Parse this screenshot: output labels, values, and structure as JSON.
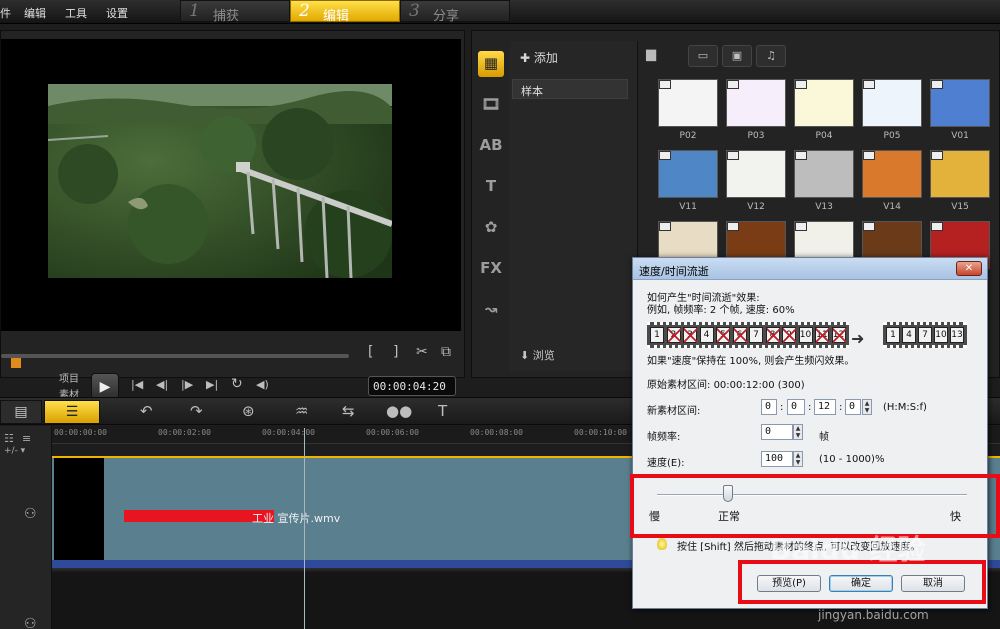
{
  "menu": {
    "items": [
      "件",
      "编辑",
      "工具",
      "设置"
    ]
  },
  "steps": [
    {
      "num": "1",
      "label": "捕获"
    },
    {
      "num": "2",
      "label": "编辑"
    },
    {
      "num": "3",
      "label": "分享"
    }
  ],
  "preview": {
    "mode_project": "项目",
    "mode_clip": "素材",
    "timecode": "00:00:04:20",
    "controls": {
      "mark_in": "[",
      "mark_out": "]",
      "cut": "✂",
      "resize": "⧉",
      "play": "▶",
      "home": "|◀",
      "prev": "◀|",
      "next": "|▶",
      "end": "▶|",
      "repeat": "↻",
      "volume": "◀)"
    }
  },
  "library": {
    "add_label": "添加",
    "folder": "样本",
    "browse_label": "浏览",
    "side_icons": [
      "media-icon",
      "transition-icon",
      "title-ab-icon",
      "text-t-icon",
      "graphics-icon",
      "fx-icon",
      "path-icon"
    ],
    "side_glyphs": [
      "▦",
      "🎞",
      "AB",
      "T",
      "✿",
      "FX",
      "↝"
    ],
    "tab_glyphs": [
      "▭",
      "▣",
      "♫"
    ],
    "thumbs": [
      {
        "label": "P02",
        "color": "#f4f4f4",
        "kind": "photo"
      },
      {
        "label": "P03",
        "color": "#f7eefb",
        "kind": "photo"
      },
      {
        "label": "P04",
        "color": "#fbf7d9",
        "kind": "photo"
      },
      {
        "label": "P05",
        "color": "#eef4fb",
        "kind": "photo"
      },
      {
        "label": "V01",
        "color": "#4e7fd0",
        "kind": "video"
      },
      {
        "label": "V11",
        "color": "#4f86c6",
        "kind": "video"
      },
      {
        "label": "V12",
        "color": "#f2f2ee",
        "kind": "video"
      },
      {
        "label": "V13",
        "color": "#bdbdbd",
        "kind": "video"
      },
      {
        "label": "V14",
        "color": "#d9792b",
        "kind": "video"
      },
      {
        "label": "V15",
        "color": "#e2b23a",
        "kind": "video"
      },
      {
        "label": "",
        "color": "#e8dcc4",
        "kind": "video"
      },
      {
        "label": "",
        "color": "#7a3c15",
        "kind": "video"
      },
      {
        "label": "",
        "color": "#f1f1ea",
        "kind": "video"
      },
      {
        "label": "",
        "color": "#6b3a18",
        "kind": "video"
      },
      {
        "label": "",
        "color": "#b52020",
        "kind": "video"
      }
    ]
  },
  "timeline": {
    "ruler": [
      "00:00:00:00",
      "00:00:02:00",
      "00:00:04:00",
      "00:00:06:00",
      "00:00:08:00",
      "00:00:10:00"
    ],
    "clip_name": "工业 宣传片.wmv",
    "tools": [
      "↶",
      "↷",
      "⊛",
      "♒",
      "⇆",
      "●●",
      "T"
    ]
  },
  "dialog": {
    "title": "速度/时间流逝",
    "close": "✕",
    "intro_line1": "如何产生\"时间流逝\"效果:",
    "intro_line2": "例如, 帧频率: 2 个帧, 速度: 60%",
    "strip_before": [
      "1",
      "2",
      "3",
      "4",
      "5",
      "6",
      "7",
      "8",
      "9",
      "10",
      "11",
      "12"
    ],
    "strip_after": [
      "1",
      "4",
      "7",
      "10",
      "13"
    ],
    "note": "如果\"速度\"保持在 100%, 则会产生频闪效果。",
    "original_label": "原始素材区间:",
    "original_value": "00:00:12:00 (300)",
    "new_label": "新素材区间:",
    "new_h": "0",
    "new_m": "0",
    "new_s": "12",
    "new_f": "0",
    "new_format": "(H:M:S:f)",
    "fps_label": "帧频率:",
    "fps_value": "0",
    "fps_unit": "帧",
    "speed_label": "速度(E):",
    "speed_value": "100",
    "speed_range": "(10 - 1000)%",
    "slider_slow": "慢",
    "slider_normal": "正常",
    "slider_fast": "快",
    "slider_value": 0.23,
    "tip": "按住 [Shift] 然后拖动素材的终点, 可以改变回放速度。",
    "btn_preview": "预览(P)",
    "btn_ok": "确定",
    "btn_cancel": "取消"
  },
  "watermark": {
    "brand": "Baidu 经验",
    "url": "jingyan.baidu.com"
  },
  "colors": {
    "accent": "#f0b400",
    "highlight": "#e80c16",
    "clip": "#5a8090"
  }
}
